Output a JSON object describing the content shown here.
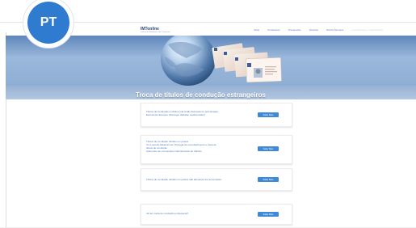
{
  "badge": "PT",
  "header": {
    "logo": "IMTonline",
    "logo_sub": "Instituto da Mobilidade e dos Transportes",
    "nav": [
      "Início",
      "Condutores",
      "Transportes",
      "Veículos",
      "Outros Serviços"
    ],
    "extra_nav": "Licenciamento / Autorizações"
  },
  "hero": {
    "title": "Troca de títulos de condução estrangeiros"
  },
  "cards": [
    {
      "text": "Títulos de Condução emitidos pela União Europeia ou pelo Espaço\nEconómico Europeu (Noruega, Islândia, Liechtenstein)",
      "button": "Saber Mais"
    },
    {
      "text": "Títulos de condução obtidos em países\nCom acordo bilateral com Portugal de reconhecimento e troca de\ntítulos de condução\nAderentes às convenções internacionais de trânsito",
      "button": "Saber Mais"
    },
    {
      "text": "Títulos de condução obtidos em países não aderentes às convenções",
      "button": "Saber Mais"
    },
    {
      "text": "Já tem carta de condução portuguesa?",
      "button": "Saber Mais"
    }
  ],
  "colors": {
    "badge": "#2f7bd0",
    "text_blue": "#4e79b5",
    "button": "#3f8ad7"
  }
}
